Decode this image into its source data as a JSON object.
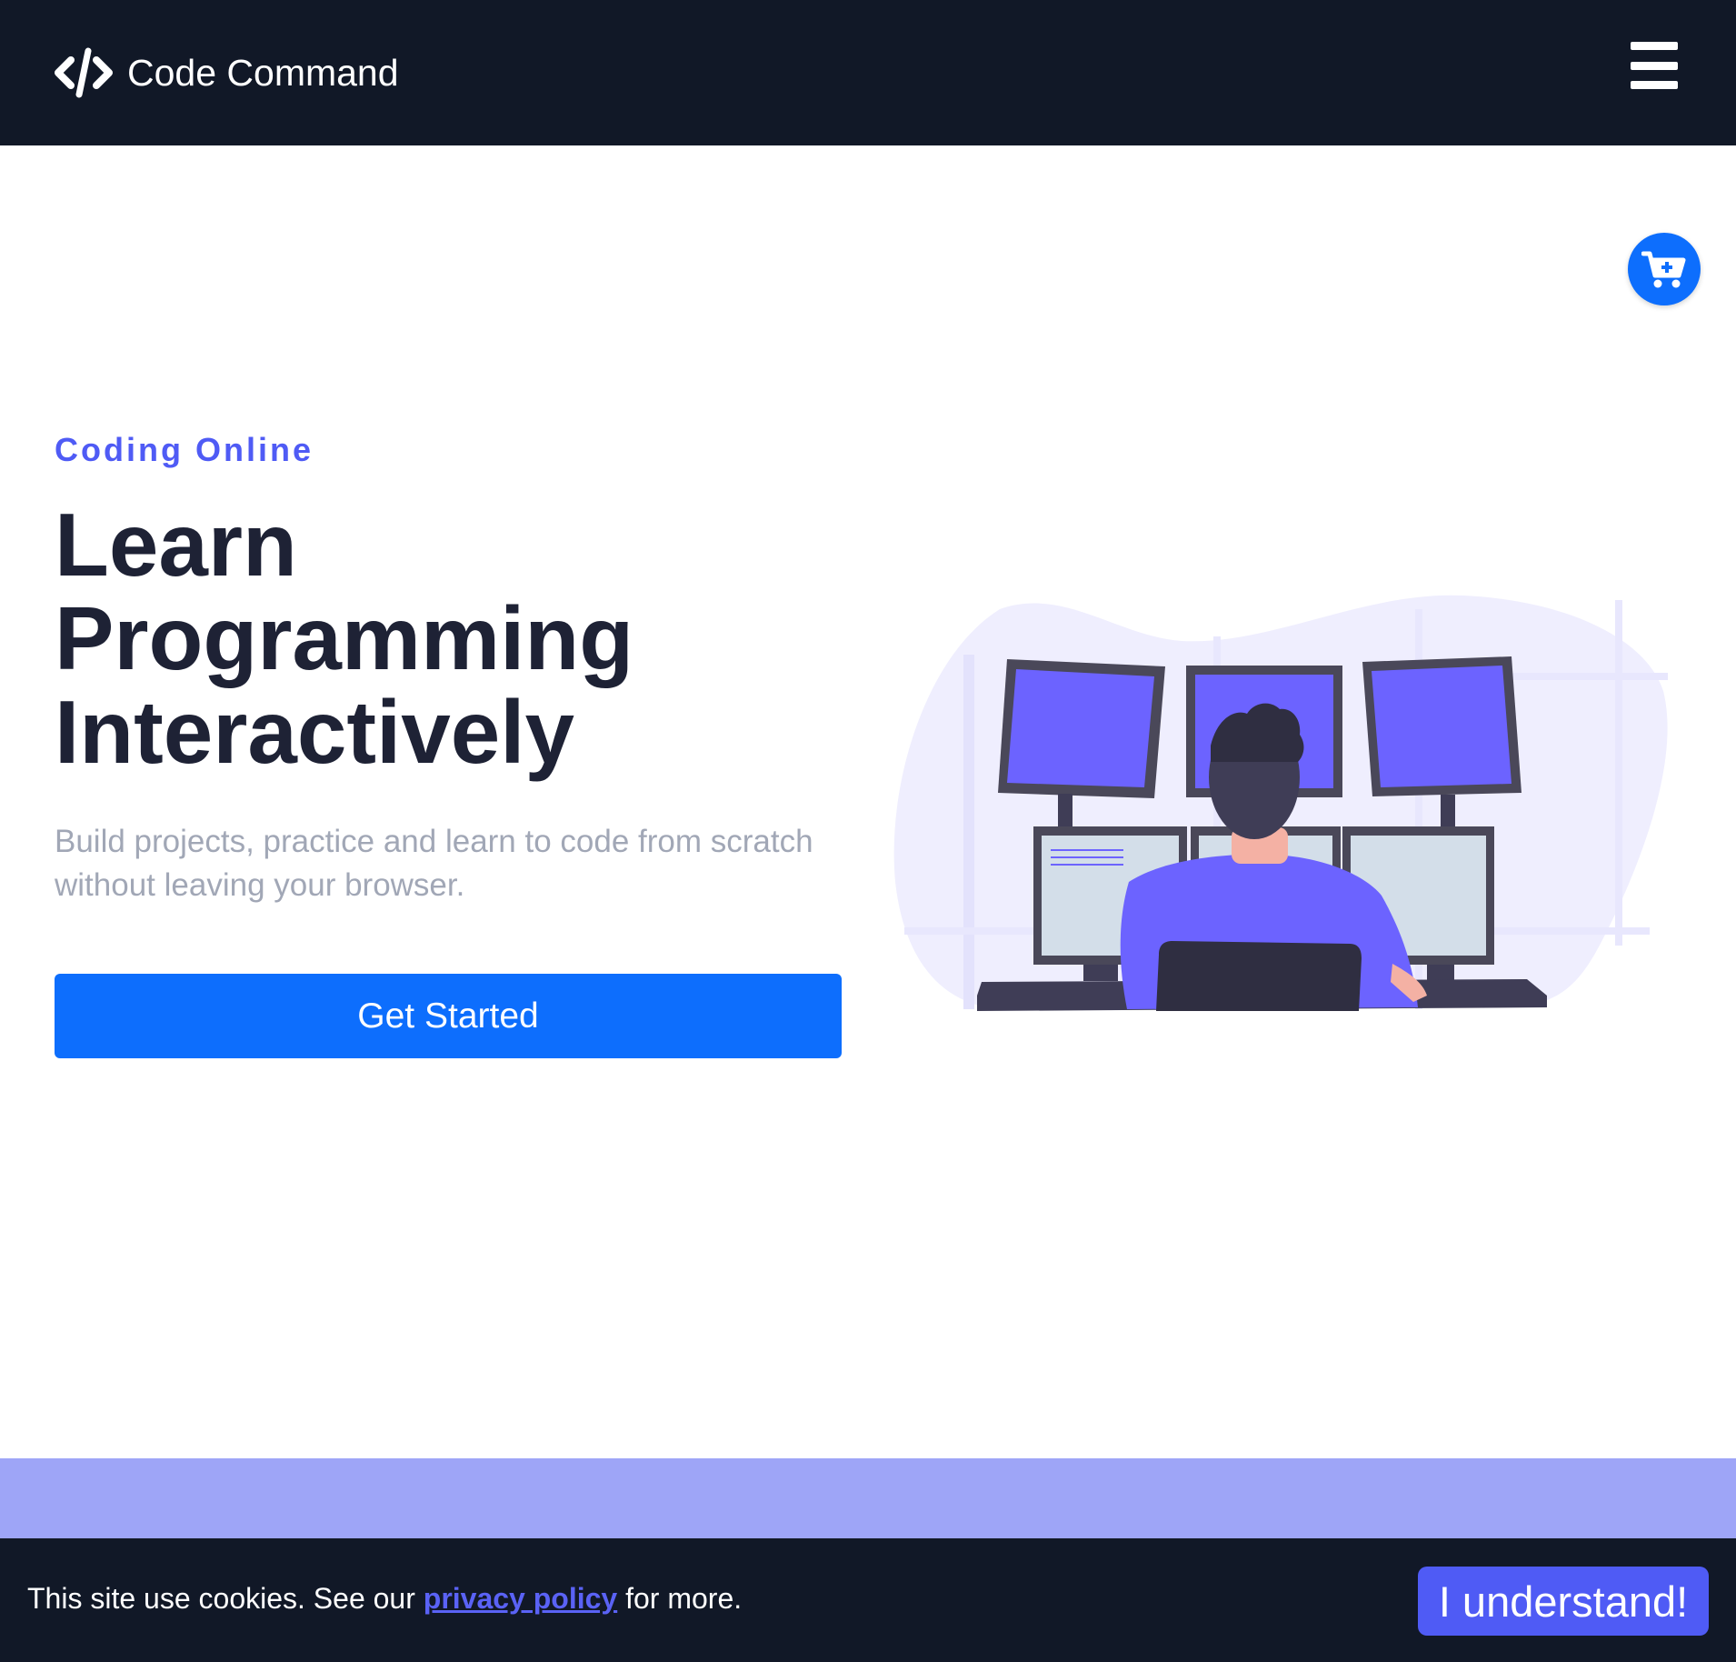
{
  "header": {
    "brand_name": "Code Command",
    "brand_icon": "code-brackets-icon",
    "menu_icon": "hamburger-menu-icon",
    "background": "#111827"
  },
  "cart": {
    "icon": "cart-plus-icon",
    "color": "#0d6efd"
  },
  "hero": {
    "eyebrow": "Coding Online",
    "title_lines": [
      "Learn",
      "Programming",
      "Interactively"
    ],
    "subtitle": "Build projects, practice and learn to code from scratch without leaving your browser.",
    "cta_label": "Get Started",
    "illustration": "programmer-at-multi-monitor-desk-illustration"
  },
  "cookie": {
    "text_before": "This site use cookies. See our ",
    "link_label": "privacy policy",
    "text_after": " for more.",
    "button_label": "I understand!"
  },
  "colors": {
    "accent": "#4f5bf5",
    "primary": "#0d6efd",
    "title": "#1e2235",
    "muted": "#a1a7b6",
    "band": "#9ea5f7"
  }
}
